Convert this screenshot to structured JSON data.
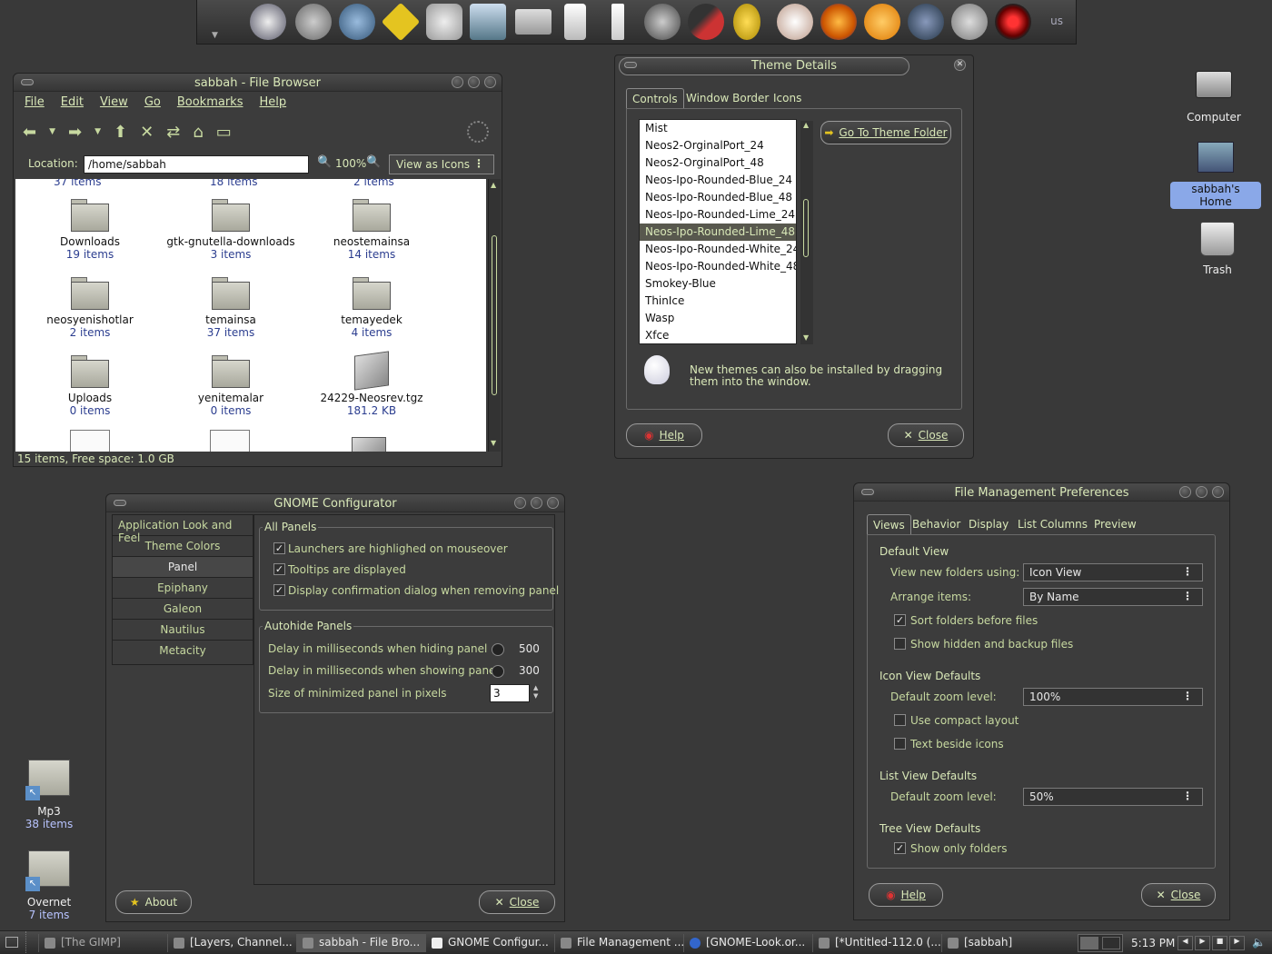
{
  "launcher": {
    "keyboard_layout": "us",
    "icons": [
      "scanner-icon",
      "mushroom-icon",
      "thunderbird-icon",
      "help-icon",
      "toaster-icon",
      "monitor-icon",
      "folder-icon",
      "ipod-icon",
      "ruler-icon",
      "globe-icon",
      "pen-icon",
      "gaim-icon",
      "rabbit-icon",
      "firefox-icon",
      "blender-icon",
      "robot-icon",
      "tools-icon",
      "hal-icon"
    ]
  },
  "file_browser": {
    "title": "sabbah - File Browser",
    "menu": [
      "File",
      "Edit",
      "View",
      "Go",
      "Bookmarks",
      "Help"
    ],
    "location_label": "Location:",
    "location_value": "/home/sabbah",
    "zoom": "100%",
    "view_as": "View as Icons",
    "items": [
      {
        "name": "Downloads",
        "info": "19 items"
      },
      {
        "name": "gtk-gnutella-downloads",
        "info": "3 items"
      },
      {
        "name": "neostemainsa",
        "info": "14 items"
      },
      {
        "name": "neosyenishotlar",
        "info": "2 items"
      },
      {
        "name": "temainsa",
        "info": "37 items"
      },
      {
        "name": "temayedek",
        "info": "4 items"
      },
      {
        "name": "Uploads",
        "info": "0 items"
      },
      {
        "name": "yenitemalar",
        "info": "0 items"
      },
      {
        "name": "24229-Neosrev.tgz",
        "info": "181.2 KB"
      }
    ],
    "status": "15 items, Free space: 1.0 GB"
  },
  "theme_details": {
    "title": "Theme Details",
    "tabs": [
      "Controls",
      "Window Border",
      "Icons"
    ],
    "themes": [
      "Mist",
      "Neos2-OrginalPort_24",
      "Neos2-OrginalPort_48",
      "Neos-Ipo-Rounded-Blue_24",
      "Neos-Ipo-Rounded-Blue_48",
      "Neos-Ipo-Rounded-Lime_24",
      "Neos-Ipo-Rounded-Lime_48",
      "Neos-Ipo-Rounded-White_24",
      "Neos-Ipo-Rounded-White_48",
      "Smokey-Blue",
      "ThinIce",
      "Wasp",
      "Xfce"
    ],
    "selected": "Neos-Ipo-Rounded-Lime_48",
    "go_to_folder": "Go To Theme Folder",
    "hint": "New themes can also be installed by dragging them into the window.",
    "help": "Help",
    "close": "Close"
  },
  "configurator": {
    "title": "GNOME Configurator",
    "nav": [
      "Application Look and Feel",
      "Theme Colors",
      "Panel",
      "Epiphany",
      "Galeon",
      "Nautilus",
      "Metacity"
    ],
    "active": "Panel",
    "all_panels_label": "All Panels",
    "checks": [
      "Launchers are highlighed on mouseover",
      "Tooltips are displayed",
      "Display confirmation dialog when removing panel"
    ],
    "autohide_label": "Autohide Panels",
    "hide_delay_label": "Delay in milliseconds when hiding panel",
    "hide_delay": "500",
    "show_delay_label": "Delay in milliseconds when showing panel",
    "show_delay": "300",
    "min_size_label": "Size of minimized panel in pixels",
    "min_size": "3",
    "about": "About",
    "close": "Close"
  },
  "file_prefs": {
    "title": "File Management Preferences",
    "tabs": [
      "Views",
      "Behavior",
      "Display",
      "List Columns",
      "Preview"
    ],
    "default_view": "Default View",
    "new_folders_label": "View new folders using:",
    "new_folders_value": "Icon View",
    "arrange_label": "Arrange items:",
    "arrange_value": "By Name",
    "sort_folders": "Sort folders before files",
    "show_hidden": "Show hidden and backup files",
    "icon_view_defaults": "Icon View Defaults",
    "icon_zoom_label": "Default zoom level:",
    "icon_zoom": "100%",
    "compact": "Use compact layout",
    "text_beside": "Text beside icons",
    "list_view_defaults": "List View Defaults",
    "list_zoom_label": "Default zoom level:",
    "list_zoom": "50%",
    "tree_view_defaults": "Tree View Defaults",
    "only_folders": "Show only folders",
    "help": "Help",
    "close": "Close"
  },
  "desktop": {
    "computer": "Computer",
    "home": "sabbah's Home",
    "trash": "Trash",
    "mp3": "Mp3",
    "mp3_info": "38 items",
    "overnet": "Overnet",
    "overnet_info": "7 items"
  },
  "taskbar": {
    "tasks": [
      "[The GIMP]",
      "[Layers, Channel...",
      "sabbah - File Bro...",
      "GNOME Configur...",
      "File Management ...",
      "[GNOME-Look.or...",
      "[*Untitled-112.0 (...",
      "[sabbah]"
    ],
    "clock": "5:13 PM"
  }
}
